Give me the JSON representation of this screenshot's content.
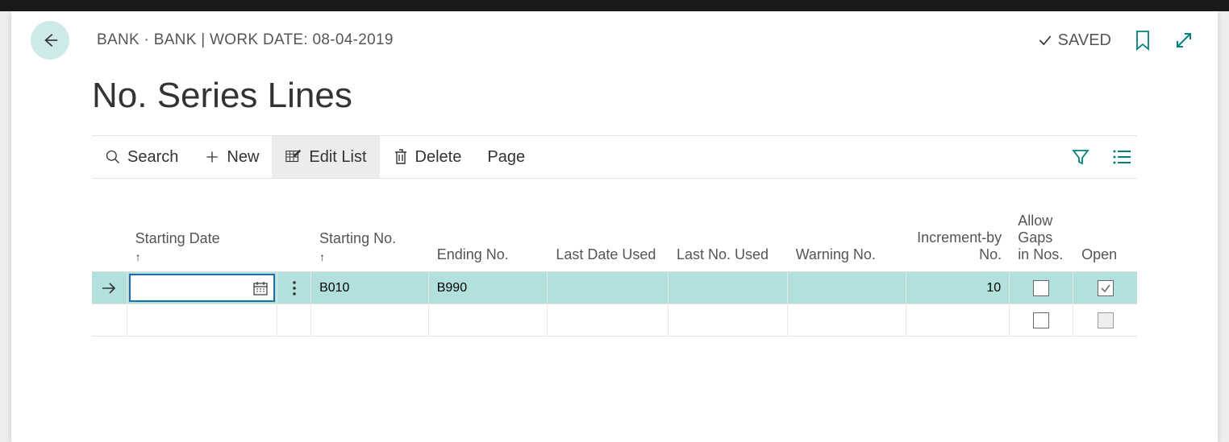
{
  "header": {
    "breadcrumb": "BANK · BANK | WORK DATE: 08-04-2019",
    "saved_label": "SAVED"
  },
  "title": "No. Series Lines",
  "toolbar": {
    "search": "Search",
    "new": "New",
    "edit_list": "Edit List",
    "delete": "Delete",
    "page": "Page"
  },
  "columns": {
    "starting_date": "Starting Date",
    "starting_no": "Starting No.",
    "ending_no": "Ending No.",
    "last_date_used": "Last Date Used",
    "last_no_used": "Last No. Used",
    "warning_no": "Warning No.",
    "increment_by": "Increment-by No.",
    "allow_gaps": "Allow Gaps in Nos.",
    "open": "Open"
  },
  "rows": [
    {
      "selected": true,
      "starting_date": "",
      "starting_no": "B010",
      "ending_no": "B990",
      "last_date_used": "",
      "last_no_used": "",
      "warning_no": "",
      "increment_by": "10",
      "allow_gaps": false,
      "open": true
    },
    {
      "selected": false,
      "starting_date": "",
      "starting_no": "",
      "ending_no": "",
      "last_date_used": "",
      "last_no_used": "",
      "warning_no": "",
      "increment_by": "",
      "allow_gaps": false,
      "open": false
    }
  ]
}
